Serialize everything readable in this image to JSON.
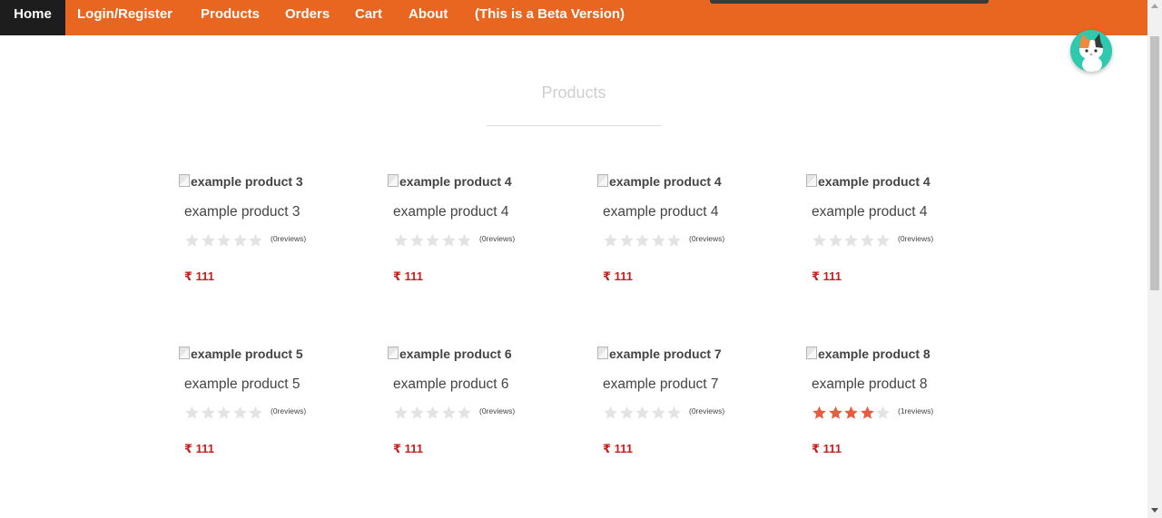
{
  "nav": {
    "home": "Home",
    "login": "Login/Register",
    "products": "Products",
    "orders": "Orders",
    "cart": "Cart",
    "about": "About",
    "beta": "(This is a Beta Version)"
  },
  "page": {
    "title": "Products"
  },
  "colors": {
    "accent": "#e8661f",
    "star_filled": "#e85d3f",
    "star_empty": "#e3e3e3",
    "price": "#cc1d1d"
  },
  "products": [
    {
      "image_alt": "example product 3",
      "name": "example product 3",
      "rating": 0,
      "reviews": "(0reviews)",
      "currency": "₹",
      "price": "111"
    },
    {
      "image_alt": "example product 4",
      "name": "example product 4",
      "rating": 0,
      "reviews": "(0reviews)",
      "currency": "₹",
      "price": "111"
    },
    {
      "image_alt": "example product 4",
      "name": "example product 4",
      "rating": 0,
      "reviews": "(0reviews)",
      "currency": "₹",
      "price": "111"
    },
    {
      "image_alt": "example product 4",
      "name": "example product 4",
      "rating": 0,
      "reviews": "(0reviews)",
      "currency": "₹",
      "price": "111"
    },
    {
      "image_alt": "example product 5",
      "name": "example product 5",
      "rating": 0,
      "reviews": "(0reviews)",
      "currency": "₹",
      "price": "111"
    },
    {
      "image_alt": "example product 6",
      "name": "example product 6",
      "rating": 0,
      "reviews": "(0reviews)",
      "currency": "₹",
      "price": "111"
    },
    {
      "image_alt": "example product 7",
      "name": "example product 7",
      "rating": 0,
      "reviews": "(0reviews)",
      "currency": "₹",
      "price": "111"
    },
    {
      "image_alt": "example product 8",
      "name": "example product 8",
      "rating": 4,
      "reviews": "(1reviews)",
      "currency": "₹",
      "price": "111"
    }
  ]
}
